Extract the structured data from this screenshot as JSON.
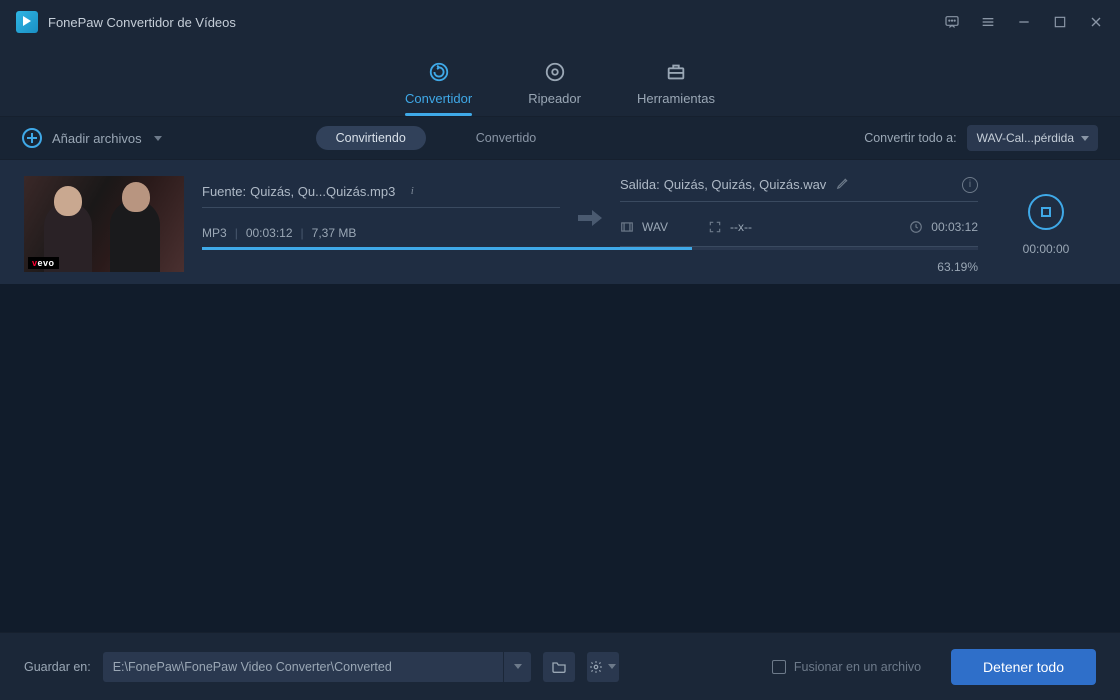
{
  "app": {
    "title": "FonePaw Convertidor de Vídeos"
  },
  "tabs": {
    "convertidor": "Convertidor",
    "ripeador": "Ripeador",
    "herramientas": "Herramientas"
  },
  "subbar": {
    "add_label": "Añadir archivos",
    "pill_active": "Convirtiendo",
    "pill_done": "Convertido",
    "convert_all_label": "Convertir todo a:",
    "convert_all_value": "WAV-Cal...pérdida"
  },
  "item": {
    "thumb_logo": "vevo",
    "source_prefix": "Fuente:",
    "source_name": "Quizás, Qu...Quizás.mp3",
    "src_format": "MP3",
    "src_duration": "00:03:12",
    "src_size": "7,37 MB",
    "output_prefix": "Salida:",
    "output_name": "Quizás, Quizás, Quizás.wav",
    "out_format": "WAV",
    "out_res": "--x--",
    "out_duration": "00:03:12",
    "progress_pct": "63.19%",
    "progress_width": "63.19%",
    "elapsed": "00:00:00"
  },
  "footer": {
    "save_label": "Guardar en:",
    "path": "E:\\FonePaw\\FonePaw Video Converter\\Converted",
    "merge_label": "Fusionar en un archivo",
    "stop_all": "Detener todo"
  }
}
